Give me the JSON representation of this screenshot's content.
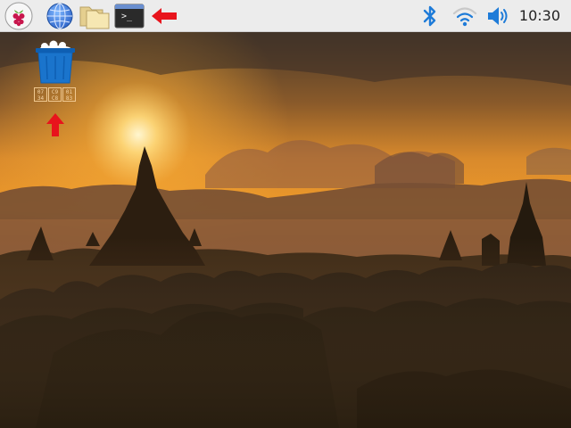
{
  "taskbar": {
    "menu_icon": "raspberry-pi-logo",
    "browser_icon": "globe-icon",
    "files_icon": "folder-icon",
    "terminal_icon": "terminal-icon",
    "terminal_prompt": ">_",
    "bluetooth_icon": "bluetooth-icon",
    "wifi_icon": "wifi-icon",
    "volume_icon": "volume-icon",
    "clock": "10:30"
  },
  "desktop": {
    "trash_icon": "trash-bin-icon",
    "trash_label_glyphs": [
      [
        "07",
        "34"
      ],
      [
        "C9",
        "C8"
      ],
      [
        "01",
        "83"
      ]
    ]
  },
  "annotations": {
    "terminal_pointer": "red-left-arrow",
    "trash_pointer": "red-up-arrow",
    "color": "#e8141c"
  },
  "colors": {
    "taskbar_bg": "#ececec",
    "accent_blue": "#1e7bd8",
    "trash_blue": "#1a74cc"
  }
}
